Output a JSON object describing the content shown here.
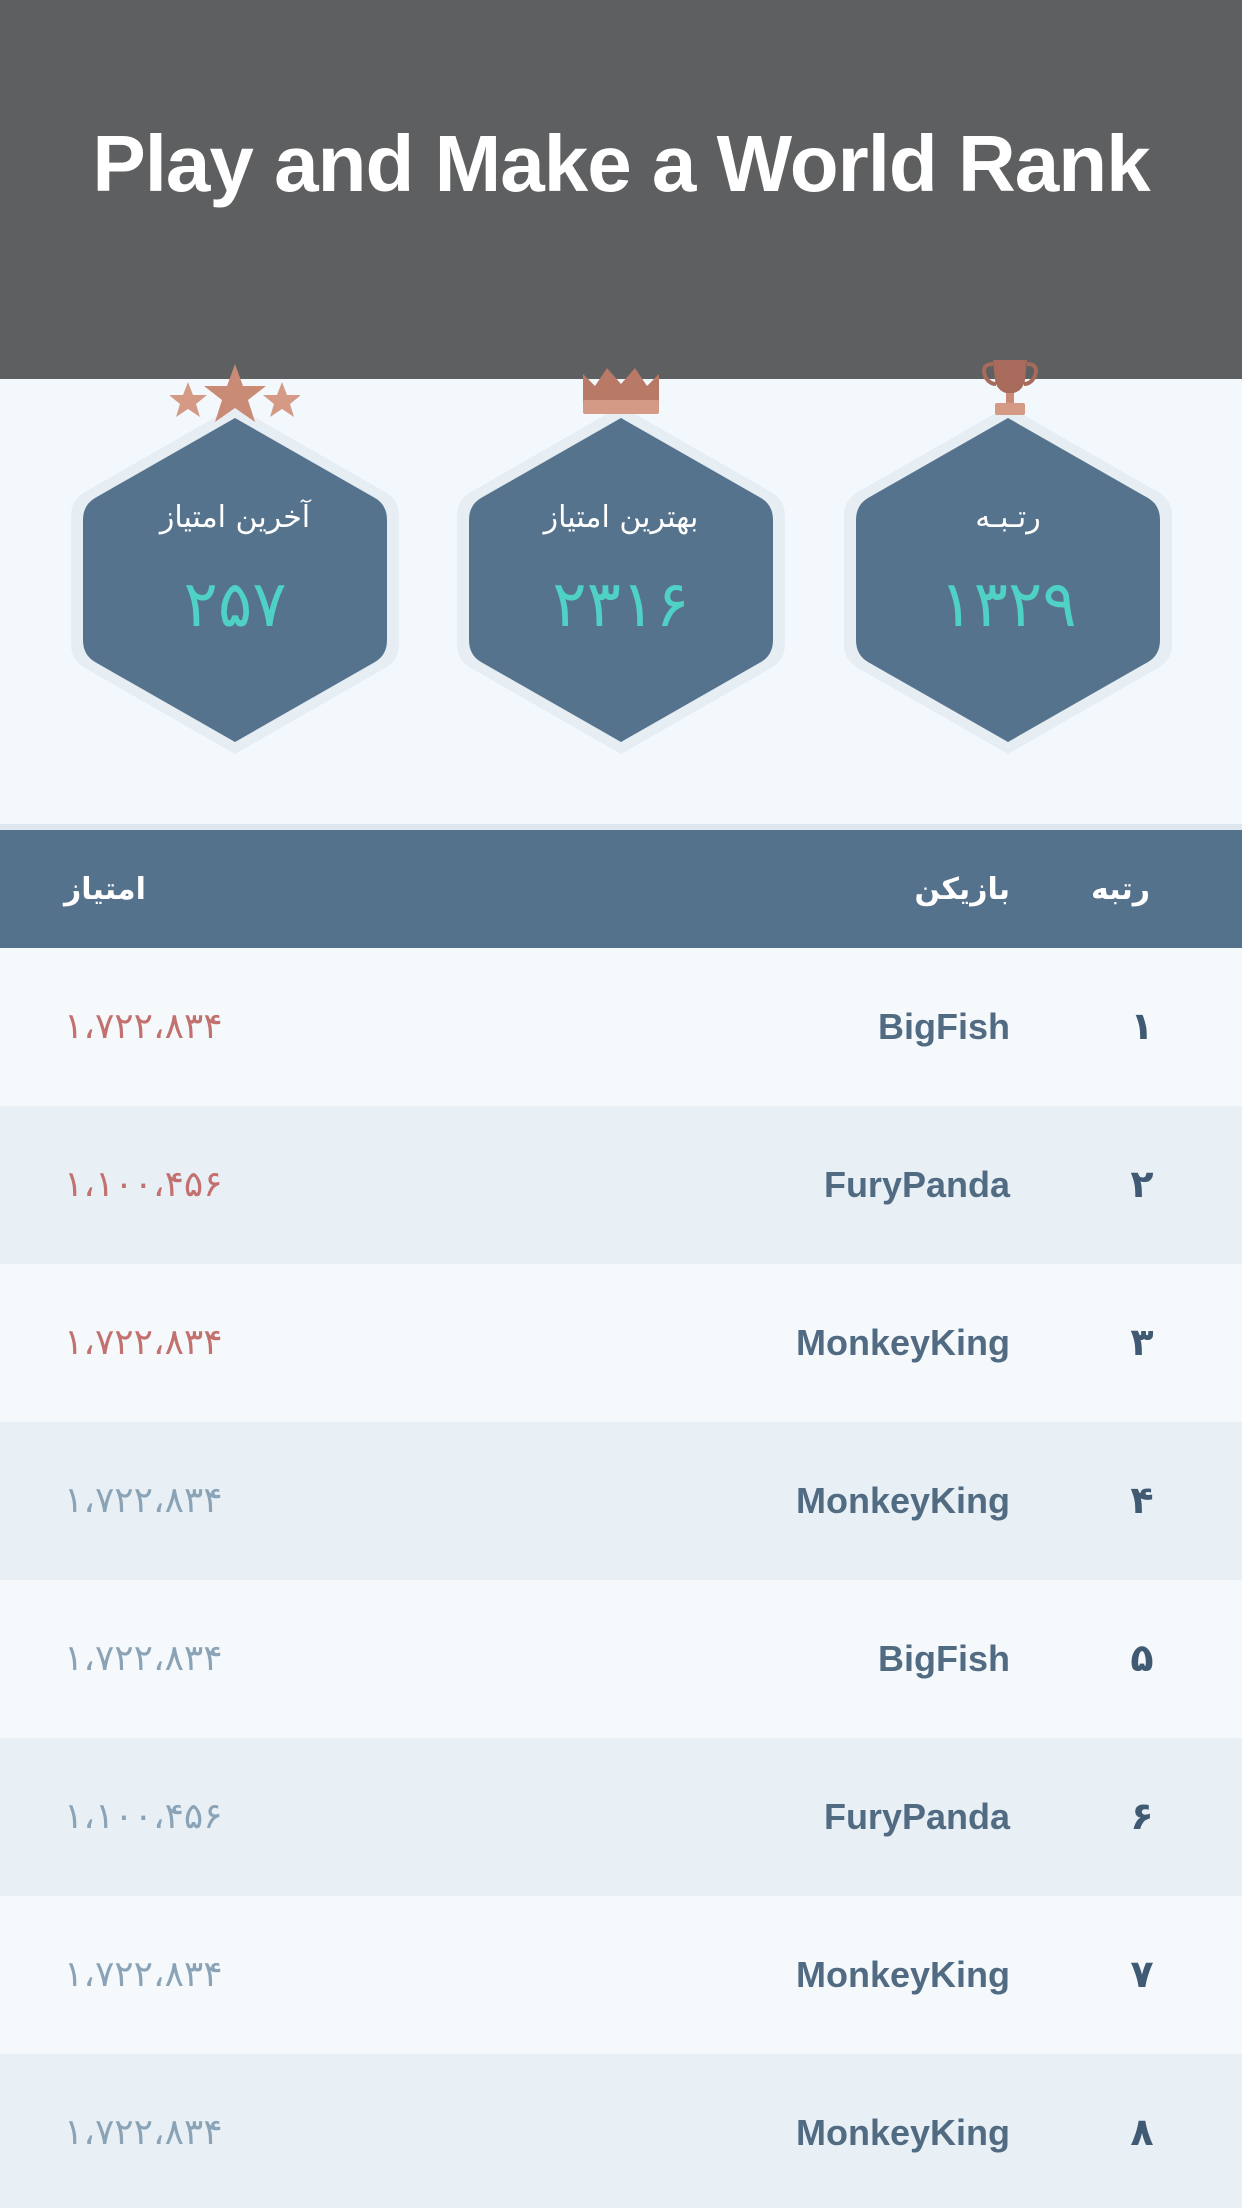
{
  "banner": {
    "title": "Play and Make a World Rank"
  },
  "stats": {
    "rank": {
      "label": "رتـبـه",
      "value": "۱۳۲۹"
    },
    "best_score": {
      "label": "بهترین امتیاز",
      "value": "۲۳۱۶"
    },
    "last_score": {
      "label": "آخرین امتیاز",
      "value": "۲۵۷"
    }
  },
  "table": {
    "headers": {
      "rank": "رتبه",
      "player": "بازیکن",
      "score": "امتیاز"
    },
    "rows": [
      {
        "rank": "۱",
        "player": "BigFish",
        "score": "۱،۷۲۲،۸۳۴",
        "highlight": true
      },
      {
        "rank": "۲",
        "player": "FuryPanda",
        "score": "۱،۱۰۰،۴۵۶",
        "highlight": true
      },
      {
        "rank": "۳",
        "player": "MonkeyKing",
        "score": "۱،۷۲۲،۸۳۴",
        "highlight": true
      },
      {
        "rank": "۴",
        "player": "MonkeyKing",
        "score": "۱،۷۲۲،۸۳۴",
        "highlight": false
      },
      {
        "rank": "۵",
        "player": "BigFish",
        "score": "۱،۷۲۲،۸۳۴",
        "highlight": false
      },
      {
        "rank": "۶",
        "player": "FuryPanda",
        "score": "۱،۱۰۰،۴۵۶",
        "highlight": false
      },
      {
        "rank": "۷",
        "player": "MonkeyKing",
        "score": "۱،۷۲۲،۸۳۴",
        "highlight": false
      },
      {
        "rank": "۸",
        "player": "MonkeyKing",
        "score": "۱،۷۲۲،۸۳۴",
        "highlight": false
      }
    ]
  },
  "colors": {
    "banner": "#5e5f60",
    "hexagon": "#56738d",
    "stat_value": "#4fd1c5",
    "header_row": "#54728c",
    "score_top3": "#c2716f",
    "score_rest": "#8aa3b6",
    "award": "#c98b75"
  },
  "icons": {
    "last_score": "three-stars-icon",
    "best_score": "crown-icon",
    "rank": "trophy-icon"
  }
}
